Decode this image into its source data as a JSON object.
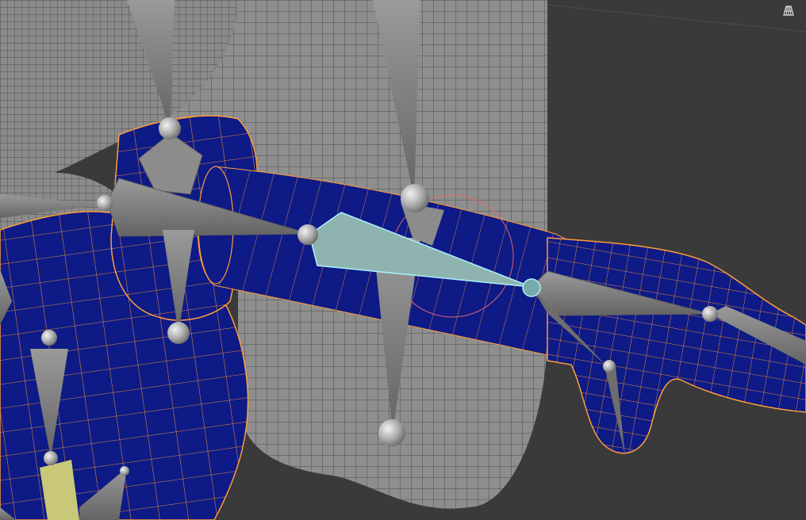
{
  "viewport": {
    "background_color": "#3a3a3a",
    "mesh_gray": "#8d8d8d",
    "mesh_wire": "#5a5a5a",
    "weight_blue": "#101a8a",
    "weight_green": "#22b515",
    "weight_yellow": "#f4e00b",
    "weight_red": "#f01d12",
    "selection_wire": "#ff9d3a",
    "active_bone_color": "#8fb4b0",
    "active_bone_outline": "#a9f2ff",
    "bone_gray": "#7f7f7f",
    "highlight_bone_color": "#c8c878"
  },
  "overlay_toggle": {
    "icon": "mesh-grid-icon",
    "tooltip": ""
  }
}
